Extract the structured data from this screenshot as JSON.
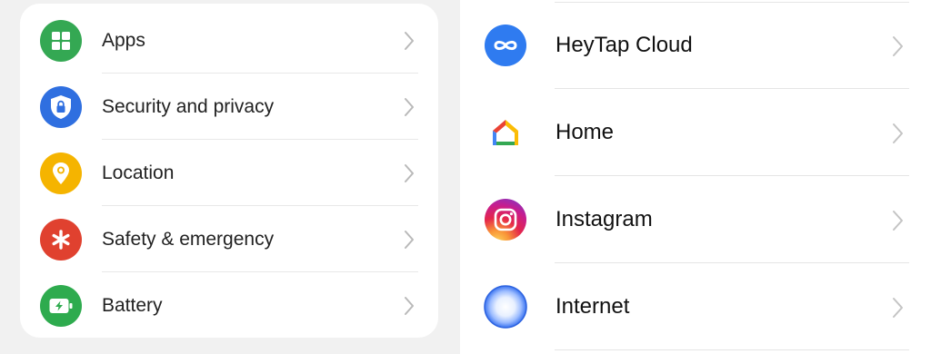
{
  "left_list": {
    "items": [
      {
        "label": "Apps",
        "icon": "apps-icon",
        "color": "#34a853"
      },
      {
        "label": "Security and privacy",
        "icon": "shield-lock-icon",
        "color": "#2f6fe0"
      },
      {
        "label": "Location",
        "icon": "location-pin-icon",
        "color": "#f5b400"
      },
      {
        "label": "Safety & emergency",
        "icon": "asterisk-icon",
        "color": "#e0412f"
      },
      {
        "label": "Battery",
        "icon": "battery-charging-icon",
        "color": "#2eab4e"
      }
    ]
  },
  "right_list": {
    "items": [
      {
        "label": "HeyTap Cloud",
        "icon": "heytap-cloud-icon",
        "color": "#2f7bf0"
      },
      {
        "label": "Home",
        "icon": "google-home-icon",
        "color": "#ea4335"
      },
      {
        "label": "Instagram",
        "icon": "instagram-icon",
        "color": "#d6249f"
      },
      {
        "label": "Internet",
        "icon": "internet-browser-icon",
        "color": "#3b82f6"
      }
    ]
  }
}
